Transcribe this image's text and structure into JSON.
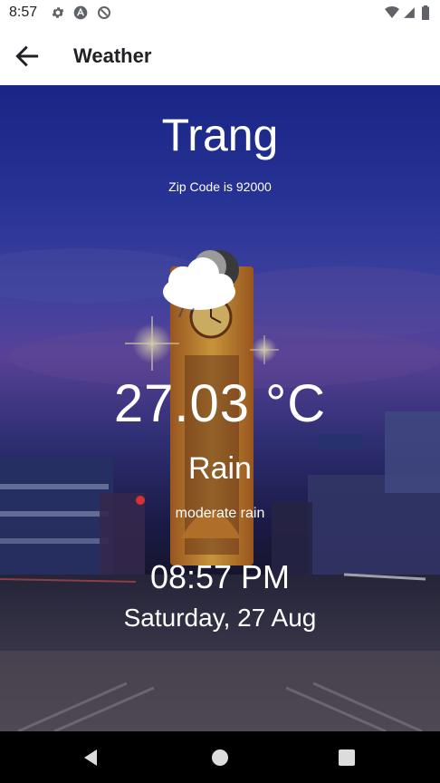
{
  "status_bar": {
    "time": "8:57",
    "icons": [
      "gear-icon",
      "a-icon",
      "sync-icon",
      "wifi-icon",
      "signal-icon",
      "battery-icon"
    ]
  },
  "app_bar": {
    "title": "Weather",
    "back_icon": "arrow-back-icon"
  },
  "weather": {
    "city": "Trang",
    "zip_text": "Zip Code is 92000",
    "icon": "cloudy-night-rain-icon",
    "temperature": "27.03 °C",
    "condition": "Rain",
    "description": "moderate rain",
    "time": "08:57 PM",
    "date": "Saturday, 27 Aug"
  },
  "nav_bar": {
    "icons": [
      "nav-back-icon",
      "nav-home-icon",
      "nav-recents-icon"
    ]
  },
  "colors": {
    "app_bar_bg": "#ffffff",
    "text_primary": "#202124",
    "overlay_text": "#ffffff",
    "sky_top": "#1f2fa0",
    "nav_bg": "#000000"
  }
}
